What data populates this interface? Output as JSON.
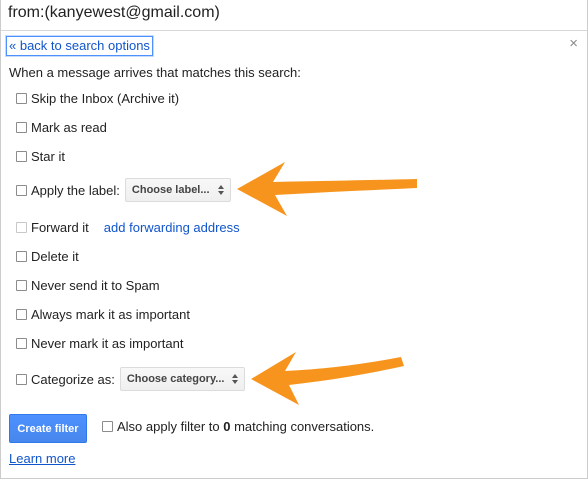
{
  "search_query": "from:(kanyewest@gmail.com)",
  "back_link": "« back to search options",
  "close_icon": "×",
  "intro_text": "When a message arrives that matches this search:",
  "options": {
    "skip_inbox": "Skip the Inbox (Archive it)",
    "mark_read": "Mark as read",
    "star_it": "Star it",
    "apply_label": "Apply the label:",
    "label_select": "Choose label...",
    "forward_it": "Forward it",
    "add_forwarding": "add forwarding address",
    "delete_it": "Delete it",
    "never_spam": "Never send it to Spam",
    "always_important": "Always mark it as important",
    "never_important": "Never mark it as important",
    "categorize_as": "Categorize as:",
    "category_select": "Choose category..."
  },
  "create_filter_button": "Create filter",
  "also_apply": {
    "prefix": "Also apply filter to",
    "count": "0",
    "suffix": "matching conversations."
  },
  "learn_more": "Learn more",
  "colors": {
    "link": "#1155cc",
    "primary_button": "#4d90fe",
    "annotation_arrow": "#f7941d"
  },
  "icons": {
    "close": "close-icon",
    "select_arrows": "up-down-arrows-icon",
    "annotation": "orange-arrow-icon"
  }
}
